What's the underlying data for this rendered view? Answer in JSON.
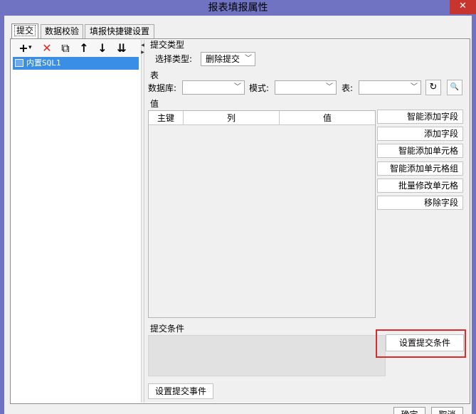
{
  "window": {
    "title": "报表填报属性",
    "close_symbol": "✕"
  },
  "tabs": [
    {
      "label": "提交",
      "active": true
    },
    {
      "label": "数据校验",
      "active": false
    },
    {
      "label": "填报快捷键设置",
      "active": false
    }
  ],
  "tree_toolbar": {
    "icons": [
      "add-icon",
      "delete-icon",
      "copy-icon",
      "move-up-icon",
      "move-down-icon",
      "move-bottom-icon"
    ],
    "glyphs": [
      "+",
      "✕",
      "⧉",
      "↑",
      "↓",
      "⇊"
    ],
    "add_dropdown": "▾"
  },
  "tree": {
    "items": [
      {
        "label": "内置SQL1",
        "selected": true
      }
    ]
  },
  "submit_type": {
    "section_label": "提交类型",
    "select_label": "选择类型:",
    "selected": "删除提交",
    "arrow": "﹀"
  },
  "table_section": {
    "section_label": "表",
    "database_label": "数据库:",
    "database_value": "",
    "schema_label": "模式:",
    "schema_value": "",
    "table_label": "表:",
    "table_value": "",
    "arrow": "﹀",
    "refresh_symbol": "↻",
    "preview_symbol": "🔍"
  },
  "values_section": {
    "section_label": "值",
    "columns": [
      "主键",
      "列",
      "值"
    ],
    "rows": [],
    "buttons": [
      "智能添加字段",
      "添加字段",
      "智能添加单元格",
      "智能添加单元格组",
      "批量修改单元格",
      "移除字段"
    ]
  },
  "condition_section": {
    "section_label": "提交条件",
    "set_condition_button": "设置提交条件"
  },
  "event_button": "设置提交事件",
  "footer": {
    "ok_button": "确定",
    "cancel_button": "取消"
  },
  "colors": {
    "titlebar": "#6f73c2",
    "close_button": "#c7352e",
    "selection": "#3a8ee6",
    "highlight_border": "#e02a2a"
  }
}
